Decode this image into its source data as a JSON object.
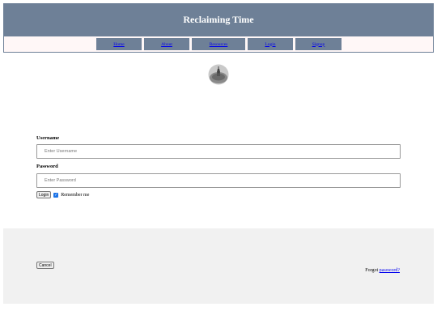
{
  "header": {
    "title": "Reclaiming Time"
  },
  "nav": {
    "items": [
      "Home",
      "About",
      "Resources",
      "Login",
      "Signup"
    ]
  },
  "logo": {
    "icon": "bell-icon"
  },
  "form": {
    "username_label": "Username",
    "username_placeholder": "Enter Username",
    "password_label": "Password",
    "password_placeholder": "Enter Password",
    "login_button": "Login",
    "remember_label": "Remember me",
    "remember_checked": true
  },
  "footer": {
    "cancel_button": "Cancel",
    "forgot_text": "Forgot",
    "forgot_link": "password?"
  },
  "colors": {
    "header_bg": "#6e8097",
    "nav_bg": "#fff7f7",
    "footer_bg": "#f1f1f1",
    "link": "#0000ee"
  }
}
